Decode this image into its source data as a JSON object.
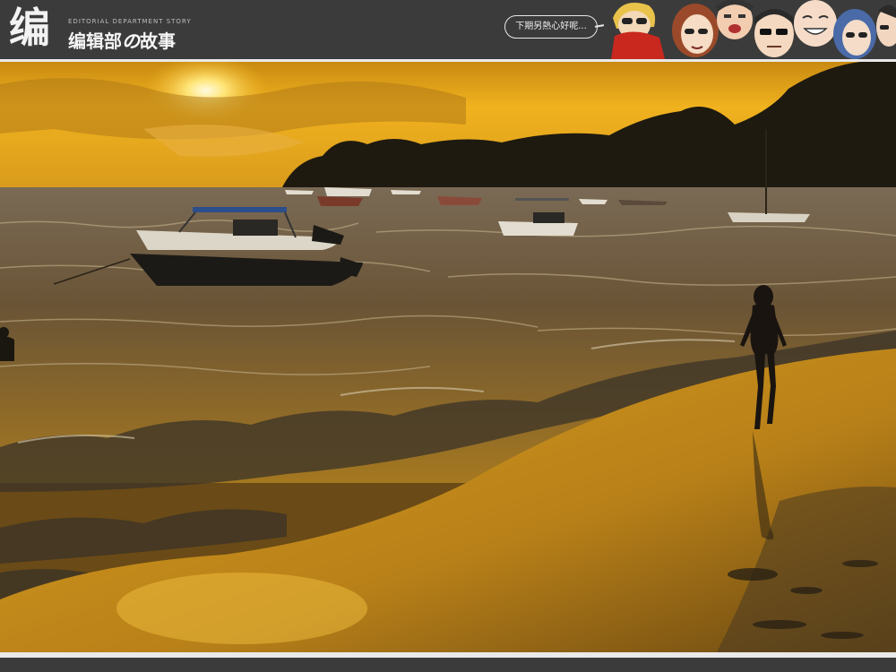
{
  "header": {
    "logo_mark": "编",
    "logo_subtitle": "EDITORIAL DEPARTMENT STORY",
    "logo_title_part1": "编辑部",
    "logo_title_accent": "の",
    "logo_title_part2": "故事",
    "speech_bubble": "下期另熱心好呢..."
  },
  "colors": {
    "header_bg": "#3b3b3b",
    "sky_top": "#f0b21e",
    "sky_horizon": "#d99615",
    "water": "#6e5a3a",
    "sand": "#d9a020"
  }
}
